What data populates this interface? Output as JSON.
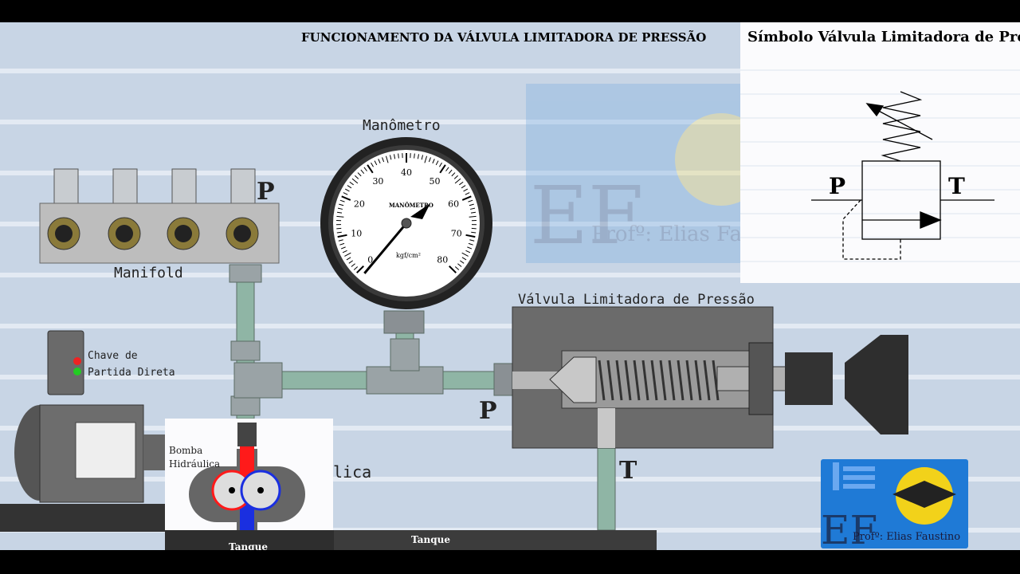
{
  "title": "FUNCIONAMENTO DA VÁLVULA LIMITADORA DE PRESSÃO",
  "symbol_panel": {
    "title": "Símbolo Válvula Limitadora de Pre",
    "port_p": "P",
    "port_t": "T"
  },
  "watermark": {
    "letters": "EF",
    "author": "Profº: Elias Faustino"
  },
  "manifold": {
    "label": "Manifold",
    "port_label": "P"
  },
  "gauge": {
    "label": "Manômetro",
    "dial_text": "MANÔMETRO",
    "unit": "kgf/cm²",
    "ticks": [
      "0",
      "10",
      "20",
      "30",
      "40",
      "50",
      "60",
      "70",
      "80"
    ],
    "reading": 0
  },
  "valve": {
    "label": "Válvula Limitadora de Pressão",
    "port_p": "P",
    "port_t": "T"
  },
  "switch": {
    "label_line1": "Chave de",
    "label_line2": "Partida Direta"
  },
  "pump": {
    "label_line1": "Bomba",
    "label_line2": "Hidráulica",
    "hidden_label_tail": "lica"
  },
  "tank": {
    "label_left": "Tanque",
    "label_right": "Tanque"
  },
  "logo": {
    "letters": "EF",
    "author": "Profº: Elias Faustino",
    "bg": "#1f7ad6"
  },
  "colors": {
    "pressure": "#ff1a1a",
    "suction": "#1a2fe0",
    "pipe": "#8fb5a5"
  }
}
